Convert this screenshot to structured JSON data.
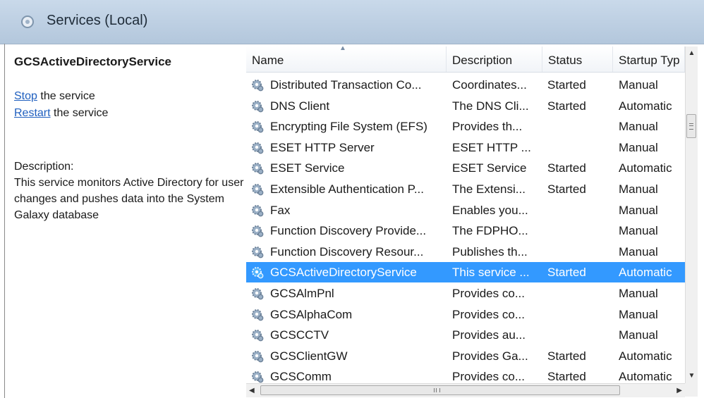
{
  "header": {
    "title": "Services (Local)"
  },
  "details": {
    "service_name": "GCSActiveDirectoryService",
    "stop_link": "Stop",
    "stop_suffix": " the service",
    "restart_link": "Restart",
    "restart_suffix": " the service",
    "description_label": "Description:",
    "description_text": "This service monitors Active Directory for user changes and pushes data into the System Galaxy database"
  },
  "columns": {
    "name": "Name",
    "description": "Description",
    "status": "Status",
    "startup": "Startup Typ"
  },
  "services": [
    {
      "name": "Distributed Transaction Co...",
      "description": "Coordinates...",
      "status": "Started",
      "startup": "Manual",
      "selected": false
    },
    {
      "name": "DNS Client",
      "description": "The DNS Cli...",
      "status": "Started",
      "startup": "Automatic",
      "selected": false
    },
    {
      "name": "Encrypting File System (EFS)",
      "description": "Provides th...",
      "status": "",
      "startup": "Manual",
      "selected": false
    },
    {
      "name": "ESET HTTP Server",
      "description": "ESET HTTP ...",
      "status": "",
      "startup": "Manual",
      "selected": false
    },
    {
      "name": "ESET Service",
      "description": "ESET Service",
      "status": "Started",
      "startup": "Automatic",
      "selected": false
    },
    {
      "name": "Extensible Authentication P...",
      "description": "The Extensi...",
      "status": "Started",
      "startup": "Manual",
      "selected": false
    },
    {
      "name": "Fax",
      "description": "Enables you...",
      "status": "",
      "startup": "Manual",
      "selected": false
    },
    {
      "name": "Function Discovery Provide...",
      "description": "The FDPHO...",
      "status": "",
      "startup": "Manual",
      "selected": false
    },
    {
      "name": "Function Discovery Resour...",
      "description": "Publishes th...",
      "status": "",
      "startup": "Manual",
      "selected": false
    },
    {
      "name": "GCSActiveDirectoryService",
      "description": "This service ...",
      "status": "Started",
      "startup": "Automatic",
      "selected": true
    },
    {
      "name": "GCSAlmPnl",
      "description": "Provides co...",
      "status": "",
      "startup": "Manual",
      "selected": false
    },
    {
      "name": "GCSAlphaCom",
      "description": "Provides co...",
      "status": "",
      "startup": "Manual",
      "selected": false
    },
    {
      "name": "GCSCCTV",
      "description": "Provides au...",
      "status": "",
      "startup": "Manual",
      "selected": false
    },
    {
      "name": "GCSClientGW",
      "description": "Provides Ga...",
      "status": "Started",
      "startup": "Automatic",
      "selected": false
    },
    {
      "name": "GCSComm",
      "description": "Provides co...",
      "status": "Started",
      "startup": "Automatic",
      "selected": false
    }
  ],
  "scrollbar": {
    "h_grip": "III"
  },
  "icons": {
    "header": "services-icon",
    "row": "gear-icon"
  },
  "colors": {
    "selection": "#3399ff",
    "link": "#1f5fbf",
    "header_bg": "#c9d9ea"
  }
}
